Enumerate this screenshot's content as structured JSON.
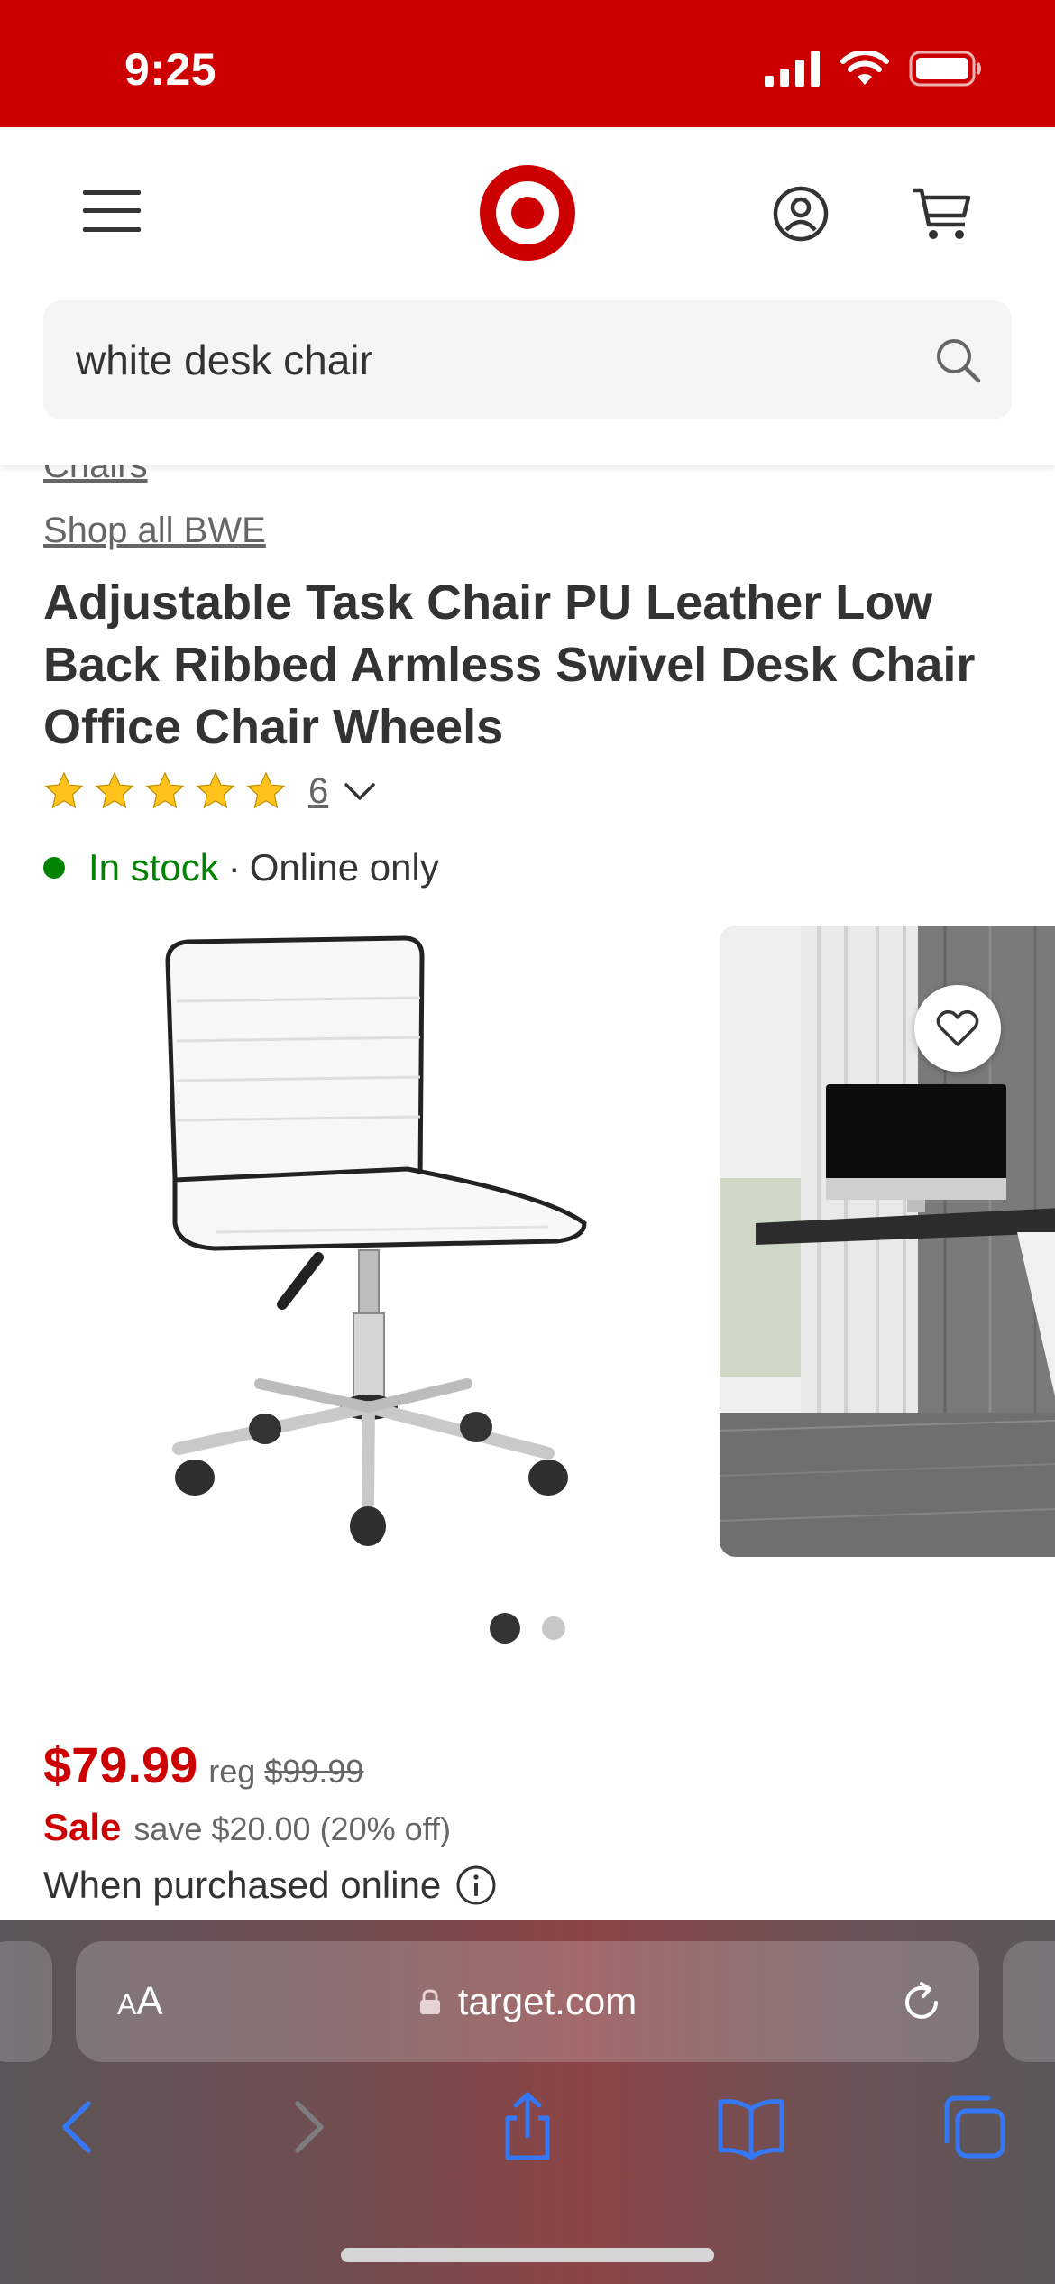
{
  "status_bar": {
    "time": "9:25"
  },
  "search": {
    "value": "white desk chair"
  },
  "product": {
    "breadcrumb_partial": "Chairs",
    "shop_all": "Shop all BWE",
    "title": "Adjustable Task Chair PU Leather Low Back Ribbed Armless Swivel Desk Chair Office Chair Wheels",
    "rating": {
      "stars": 5,
      "count": "6"
    },
    "stock": {
      "status": "In stock",
      "separator": "·",
      "channel": "Online only"
    },
    "gallery": {
      "image_count": 2,
      "active_index": 0
    },
    "price": {
      "current": "$79.99",
      "reg_label": "reg",
      "reg_price": "$99.99",
      "sale_label": "Sale",
      "save_text": "save $20.00 (20% off)",
      "purchase_note": "When purchased online"
    }
  },
  "browser": {
    "aa_small": "A",
    "aa_large": "A",
    "url": "target.com"
  },
  "colors": {
    "brand_red": "#cc0000",
    "in_stock_green": "#008300",
    "link_blue": "#3478f6"
  }
}
